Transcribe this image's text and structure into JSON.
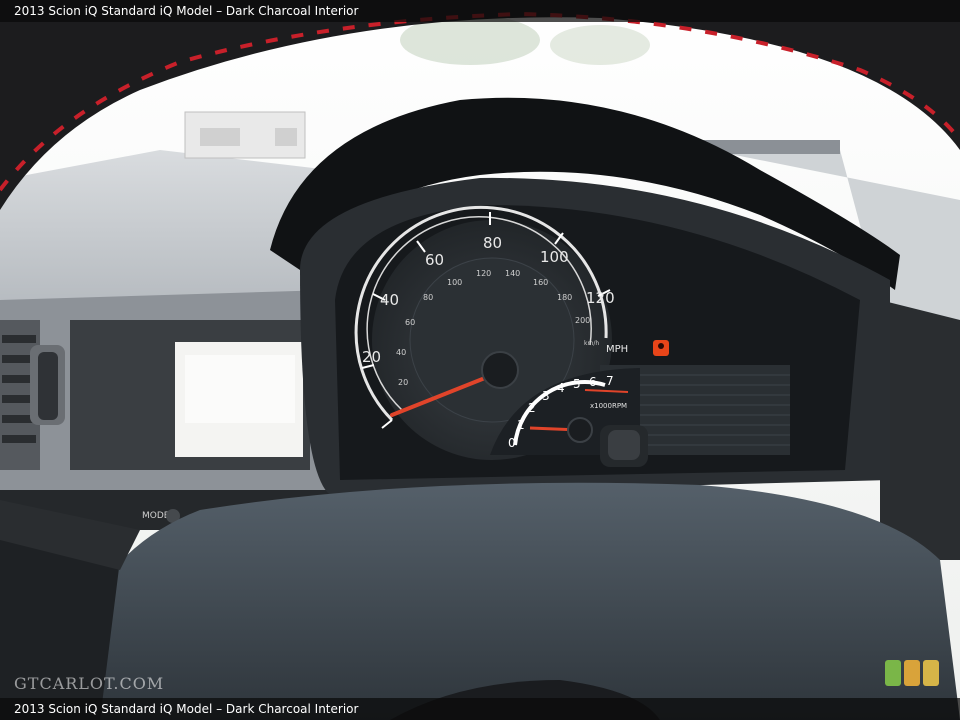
{
  "caption": "2013 Scion iQ Standard iQ Model – Dark Charcoal Interior",
  "watermark": "GTCARLOT.COM",
  "speedometer": {
    "mph_ticks": [
      "20",
      "40",
      "60",
      "80",
      "100",
      "120"
    ],
    "kmh_ticks": [
      "20",
      "40",
      "60",
      "80",
      "100",
      "120",
      "140",
      "160",
      "180",
      "200"
    ],
    "mph_unit": "MPH",
    "kmh_unit": "km/h"
  },
  "tachometer": {
    "ticks": [
      "0",
      "1",
      "2",
      "3",
      "4",
      "5",
      "6",
      "7"
    ],
    "unit": "x1000RPM"
  },
  "dash_label": "MODE",
  "size_buttons": [
    {
      "color": "#7ab648"
    },
    {
      "color": "#d9a33a"
    },
    {
      "color": "#d6b548"
    }
  ],
  "colors": {
    "stitching": "#c8202a",
    "needle": "#e0442a",
    "warning_light": "#ff4a1a"
  }
}
